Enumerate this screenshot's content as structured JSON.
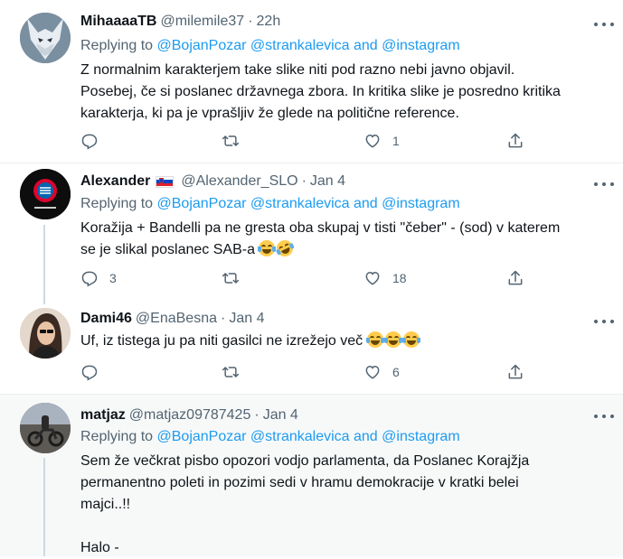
{
  "tweets": [
    {
      "name": "MihaaaaTB",
      "handle": "@milemile37",
      "time": "22h",
      "replying_prefix": "Replying to ",
      "reply_users": [
        "@BojanPozar",
        "@strankalevica",
        "and",
        "@instagram"
      ],
      "lines": [
        "Z normalnim karakterjem take slike niti pod razno nebi javno objavil.",
        "Posebej, če si poslanec državnega zbora. In kritika slike je posredno kritika",
        "karakterja, ki pa je vprašljiv že glede na politične reference."
      ],
      "replies": "",
      "retweets": "",
      "likes": "1",
      "avatar": "wolf-avatar"
    },
    {
      "name": "Alexander",
      "flag": "slovenia-flag",
      "handle": "@Alexander_SLO",
      "time": "Jan 4",
      "replying_prefix": "Replying to ",
      "reply_users": [
        "@BojanPozar",
        "@strankalevica",
        "and",
        "@instagram"
      ],
      "lines": [
        "Koražija + Bandelli pa ne gresta oba skupaj v tisti \"čeber\" - (sod) v katerem",
        "se je slikal poslanec SAB-a"
      ],
      "emojis": [
        "face-with-tears-of-joy",
        "rolling-on-floor-laughing"
      ],
      "replies": "3",
      "retweets": "",
      "likes": "18",
      "avatar": "bayern-avatar"
    },
    {
      "name": "Dami46",
      "handle": "@EnaBesna",
      "time": "Jan 4",
      "lines": [
        "Uf, iz tistega ju pa niti gasilci ne izrežejo več"
      ],
      "emojis": [
        "face-with-tears-of-joy",
        "face-with-tears-of-joy",
        "face-with-tears-of-joy"
      ],
      "replies": "",
      "retweets": "",
      "likes": "6",
      "avatar": "woman-avatar"
    },
    {
      "name": "matjaz",
      "handle": "@matjaz09787425",
      "time": "Jan 4",
      "replying_prefix": "Replying to ",
      "reply_users": [
        "@BojanPozar",
        "@strankalevica",
        "and",
        "@instagram"
      ],
      "lines": [
        "Sem že večkrat pisbo opozori vodjo parlamenta, da Poslanec Korajžja",
        "permanentno poleti in pozimi sedi v hramu demokracije v kratki belei",
        "majci..!!",
        "",
        "Halo -"
      ],
      "avatar": "motorcycle-avatar"
    }
  ],
  "dot": "·",
  "more_icon": "more-dots-icon",
  "colors": {
    "link": "#1d9bf0",
    "muted": "#536471",
    "text": "#0f1419",
    "line": "#cfd9de"
  }
}
